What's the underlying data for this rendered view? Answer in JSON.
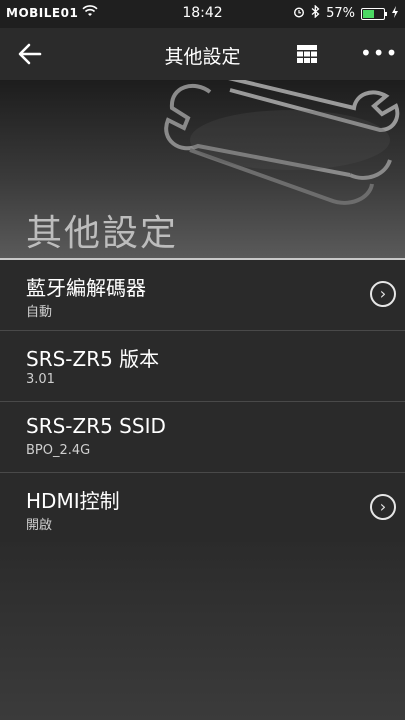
{
  "status_bar": {
    "carrier": "MOBILE01",
    "time": "18:42",
    "battery_percent": "57%",
    "battery_level": 0.57,
    "icons": [
      "wifi-icon",
      "alarm-icon",
      "bluetooth-icon",
      "battery-icon",
      "charging-icon"
    ]
  },
  "nav": {
    "title": "其他設定",
    "back_icon": "back-arrow-icon",
    "grid_icon": "grid-icon",
    "more_icon": "more-icon"
  },
  "hero": {
    "title": "其他設定"
  },
  "settings": [
    {
      "label": "藍牙編解碼器",
      "value": "自動",
      "has_chevron": true
    },
    {
      "label": "SRS-ZR5 版本",
      "value": "3.01",
      "has_chevron": false
    },
    {
      "label": "SRS-ZR5 SSID",
      "value": "BPO_2.4G",
      "has_chevron": false
    },
    {
      "label": "HDMI控制",
      "value": "開啟",
      "has_chevron": true
    }
  ],
  "colors": {
    "background": "#2a2a2a",
    "battery_green": "#4cd964",
    "divider": "#c9c9c9"
  }
}
